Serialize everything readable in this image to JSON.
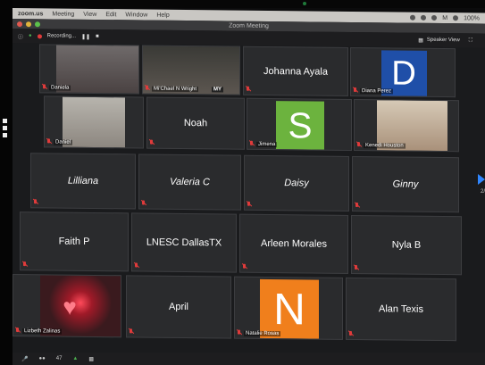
{
  "macbar": {
    "menu": [
      "zoom.us",
      "Meeting",
      "View",
      "Edit",
      "Window",
      "Help"
    ],
    "battery": "100%"
  },
  "window": {
    "title": "Zoom Meeting"
  },
  "toolbar": {
    "recording": "Recording...",
    "speaker_view": "Speaker View"
  },
  "tiles": [
    {
      "id": "daniela",
      "name": "Daniela",
      "label": "Daniela",
      "video": true
    },
    {
      "id": "mchael",
      "name": "Mi'Chael N Wright",
      "label": "Mi'Chael N Wright",
      "badge": "MY",
      "video": true
    },
    {
      "id": "johanna",
      "name": "Johanna Ayala",
      "label": ""
    },
    {
      "id": "diana",
      "name": "Diana Perez",
      "label": "Diana Perez",
      "avatar": "D",
      "avatar_color": "#1f4fa8"
    },
    {
      "id": "daniel",
      "name": "Daniel",
      "label": "Daniel",
      "video": true
    },
    {
      "id": "noah",
      "name": "Noah",
      "label": ""
    },
    {
      "id": "jimena",
      "name": "Jimena",
      "label": "Jimena",
      "avatar": "S",
      "avatar_color": "#6cb33e"
    },
    {
      "id": "kenedi",
      "name": "Kenedi Houston",
      "label": "Kenedi Houston",
      "video": true
    },
    {
      "id": "lilliana",
      "name": "Lilliana",
      "label": ""
    },
    {
      "id": "valeria",
      "name": "Valeria C",
      "label": ""
    },
    {
      "id": "daisy",
      "name": "Daisy",
      "label": ""
    },
    {
      "id": "ginny",
      "name": "Ginny",
      "label": ""
    },
    {
      "id": "faith",
      "name": "Faith P",
      "label": ""
    },
    {
      "id": "lnesc",
      "name": "LNESC DallasTX",
      "label": ""
    },
    {
      "id": "arleen",
      "name": "Arleen Morales",
      "label": ""
    },
    {
      "id": "nyla",
      "name": "Nyla B",
      "label": ""
    },
    {
      "id": "lizbeth",
      "name": "Lizbeth Zalinas",
      "label": "Lizbeth Zalinas",
      "video": true
    },
    {
      "id": "april",
      "name": "April",
      "label": ""
    },
    {
      "id": "natalie",
      "name": "Natalie Rosas",
      "label": "Natalie Rosas",
      "avatar": "N",
      "avatar_color": "#f07f1c"
    },
    {
      "id": "alan",
      "name": "Alan Texis",
      "label": ""
    }
  ],
  "sidebar": {
    "page": "2/"
  },
  "bottombar": {
    "participants": "47"
  }
}
